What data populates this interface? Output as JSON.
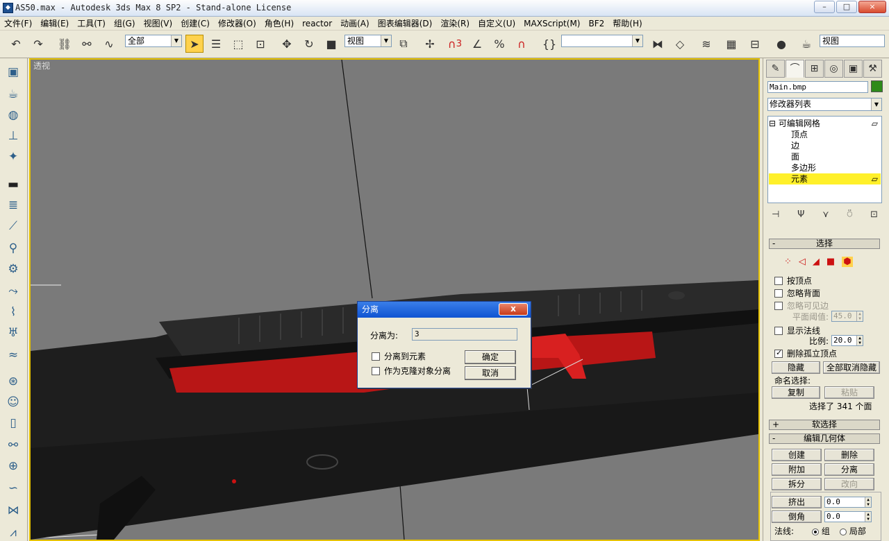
{
  "window": {
    "title": "AS50.max - Autodesk 3ds Max 8 SP2  - Stand-alone License",
    "controls": [
      "–",
      "□",
      "×"
    ]
  },
  "menu": [
    "文件(F)",
    "编辑(E)",
    "工具(T)",
    "组(G)",
    "视图(V)",
    "创建(C)",
    "修改器(O)",
    "角色(H)",
    "reactor",
    "动画(A)",
    "图表编辑器(D)",
    "渲染(R)",
    "自定义(U)",
    "MAXScript(M)",
    "BF2",
    "帮助(H)"
  ],
  "toolbar": {
    "selection_filter": "全部",
    "ref_coord": "视图",
    "named_selection": "",
    "view_dropdown": "视图",
    "snap_3": "3"
  },
  "viewport": {
    "label": "透视"
  },
  "dialog": {
    "title": "分离",
    "close": "x",
    "detach_as_label": "分离为:",
    "detach_as_value": "3",
    "to_element_label": "分离到元素",
    "to_element_checked": false,
    "as_clone_label": "作为克隆对象分离",
    "as_clone_checked": false,
    "ok": "确定",
    "cancel": "取消"
  },
  "command_panel": {
    "object_name": "Main.bmp",
    "object_color": "#2e8a1a",
    "modifier_list": "修改器列表",
    "stack": {
      "root": "可编辑网格",
      "items": [
        "顶点",
        "边",
        "面",
        "多边形",
        "元素"
      ],
      "selected": "元素"
    },
    "selection": {
      "title": "选择",
      "by_vertex": "按顶点",
      "ignore_backfacing": "忽略背面",
      "ignore_visible_edges": "忽略可见边",
      "planar_thresh_label": "平面阈值:",
      "planar_thresh_value": "45.0",
      "show_normals": "显示法线",
      "scale_label": "比例:",
      "scale_value": "20.0",
      "delete_isolated": "删除孤立顶点",
      "delete_isolated_checked": true,
      "hide": "隐藏",
      "unhide_all": "全部取消隐藏",
      "named_sel_label": "命名选择:",
      "copy": "复制",
      "paste": "粘贴",
      "status": "选择了 341 个面"
    },
    "soft_selection": {
      "title": "软选择",
      "sign": "+"
    },
    "edit_geometry": {
      "title": "编辑几何体",
      "sign": "-",
      "create": "创建",
      "delete": "删除",
      "attach": "附加",
      "detach": "分离",
      "break": "拆分",
      "turn": "改向",
      "extrude": "挤出",
      "extrude_value": "0.0",
      "chamfer": "倒角",
      "chamfer_value": "0.0",
      "normal_label": "法线:",
      "normal_group": "组",
      "normal_local": "局部"
    }
  }
}
